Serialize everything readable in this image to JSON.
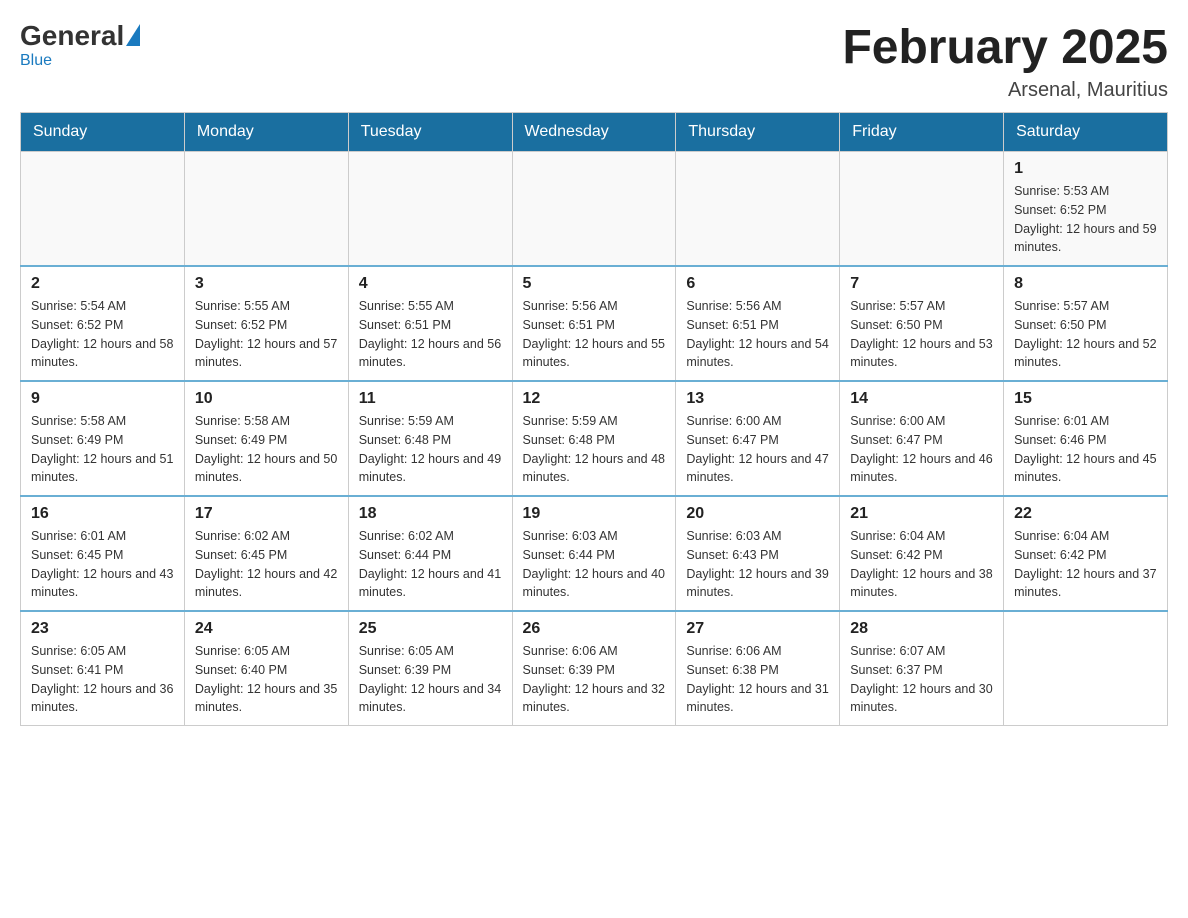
{
  "header": {
    "title": "February 2025",
    "location": "Arsenal, Mauritius"
  },
  "logo": {
    "general": "General",
    "blue": "Blue"
  },
  "days_of_week": [
    "Sunday",
    "Monday",
    "Tuesday",
    "Wednesday",
    "Thursday",
    "Friday",
    "Saturday"
  ],
  "weeks": [
    {
      "days": [
        {
          "empty": true
        },
        {
          "empty": true
        },
        {
          "empty": true
        },
        {
          "empty": true
        },
        {
          "empty": true
        },
        {
          "empty": true
        },
        {
          "number": "1",
          "sunrise": "Sunrise: 5:53 AM",
          "sunset": "Sunset: 6:52 PM",
          "daylight": "Daylight: 12 hours and 59 minutes."
        }
      ]
    },
    {
      "days": [
        {
          "number": "2",
          "sunrise": "Sunrise: 5:54 AM",
          "sunset": "Sunset: 6:52 PM",
          "daylight": "Daylight: 12 hours and 58 minutes."
        },
        {
          "number": "3",
          "sunrise": "Sunrise: 5:55 AM",
          "sunset": "Sunset: 6:52 PM",
          "daylight": "Daylight: 12 hours and 57 minutes."
        },
        {
          "number": "4",
          "sunrise": "Sunrise: 5:55 AM",
          "sunset": "Sunset: 6:51 PM",
          "daylight": "Daylight: 12 hours and 56 minutes."
        },
        {
          "number": "5",
          "sunrise": "Sunrise: 5:56 AM",
          "sunset": "Sunset: 6:51 PM",
          "daylight": "Daylight: 12 hours and 55 minutes."
        },
        {
          "number": "6",
          "sunrise": "Sunrise: 5:56 AM",
          "sunset": "Sunset: 6:51 PM",
          "daylight": "Daylight: 12 hours and 54 minutes."
        },
        {
          "number": "7",
          "sunrise": "Sunrise: 5:57 AM",
          "sunset": "Sunset: 6:50 PM",
          "daylight": "Daylight: 12 hours and 53 minutes."
        },
        {
          "number": "8",
          "sunrise": "Sunrise: 5:57 AM",
          "sunset": "Sunset: 6:50 PM",
          "daylight": "Daylight: 12 hours and 52 minutes."
        }
      ]
    },
    {
      "days": [
        {
          "number": "9",
          "sunrise": "Sunrise: 5:58 AM",
          "sunset": "Sunset: 6:49 PM",
          "daylight": "Daylight: 12 hours and 51 minutes."
        },
        {
          "number": "10",
          "sunrise": "Sunrise: 5:58 AM",
          "sunset": "Sunset: 6:49 PM",
          "daylight": "Daylight: 12 hours and 50 minutes."
        },
        {
          "number": "11",
          "sunrise": "Sunrise: 5:59 AM",
          "sunset": "Sunset: 6:48 PM",
          "daylight": "Daylight: 12 hours and 49 minutes."
        },
        {
          "number": "12",
          "sunrise": "Sunrise: 5:59 AM",
          "sunset": "Sunset: 6:48 PM",
          "daylight": "Daylight: 12 hours and 48 minutes."
        },
        {
          "number": "13",
          "sunrise": "Sunrise: 6:00 AM",
          "sunset": "Sunset: 6:47 PM",
          "daylight": "Daylight: 12 hours and 47 minutes."
        },
        {
          "number": "14",
          "sunrise": "Sunrise: 6:00 AM",
          "sunset": "Sunset: 6:47 PM",
          "daylight": "Daylight: 12 hours and 46 minutes."
        },
        {
          "number": "15",
          "sunrise": "Sunrise: 6:01 AM",
          "sunset": "Sunset: 6:46 PM",
          "daylight": "Daylight: 12 hours and 45 minutes."
        }
      ]
    },
    {
      "days": [
        {
          "number": "16",
          "sunrise": "Sunrise: 6:01 AM",
          "sunset": "Sunset: 6:45 PM",
          "daylight": "Daylight: 12 hours and 43 minutes."
        },
        {
          "number": "17",
          "sunrise": "Sunrise: 6:02 AM",
          "sunset": "Sunset: 6:45 PM",
          "daylight": "Daylight: 12 hours and 42 minutes."
        },
        {
          "number": "18",
          "sunrise": "Sunrise: 6:02 AM",
          "sunset": "Sunset: 6:44 PM",
          "daylight": "Daylight: 12 hours and 41 minutes."
        },
        {
          "number": "19",
          "sunrise": "Sunrise: 6:03 AM",
          "sunset": "Sunset: 6:44 PM",
          "daylight": "Daylight: 12 hours and 40 minutes."
        },
        {
          "number": "20",
          "sunrise": "Sunrise: 6:03 AM",
          "sunset": "Sunset: 6:43 PM",
          "daylight": "Daylight: 12 hours and 39 minutes."
        },
        {
          "number": "21",
          "sunrise": "Sunrise: 6:04 AM",
          "sunset": "Sunset: 6:42 PM",
          "daylight": "Daylight: 12 hours and 38 minutes."
        },
        {
          "number": "22",
          "sunrise": "Sunrise: 6:04 AM",
          "sunset": "Sunset: 6:42 PM",
          "daylight": "Daylight: 12 hours and 37 minutes."
        }
      ]
    },
    {
      "days": [
        {
          "number": "23",
          "sunrise": "Sunrise: 6:05 AM",
          "sunset": "Sunset: 6:41 PM",
          "daylight": "Daylight: 12 hours and 36 minutes."
        },
        {
          "number": "24",
          "sunrise": "Sunrise: 6:05 AM",
          "sunset": "Sunset: 6:40 PM",
          "daylight": "Daylight: 12 hours and 35 minutes."
        },
        {
          "number": "25",
          "sunrise": "Sunrise: 6:05 AM",
          "sunset": "Sunset: 6:39 PM",
          "daylight": "Daylight: 12 hours and 34 minutes."
        },
        {
          "number": "26",
          "sunrise": "Sunrise: 6:06 AM",
          "sunset": "Sunset: 6:39 PM",
          "daylight": "Daylight: 12 hours and 32 minutes."
        },
        {
          "number": "27",
          "sunrise": "Sunrise: 6:06 AM",
          "sunset": "Sunset: 6:38 PM",
          "daylight": "Daylight: 12 hours and 31 minutes."
        },
        {
          "number": "28",
          "sunrise": "Sunrise: 6:07 AM",
          "sunset": "Sunset: 6:37 PM",
          "daylight": "Daylight: 12 hours and 30 minutes."
        },
        {
          "empty": true
        }
      ]
    }
  ]
}
